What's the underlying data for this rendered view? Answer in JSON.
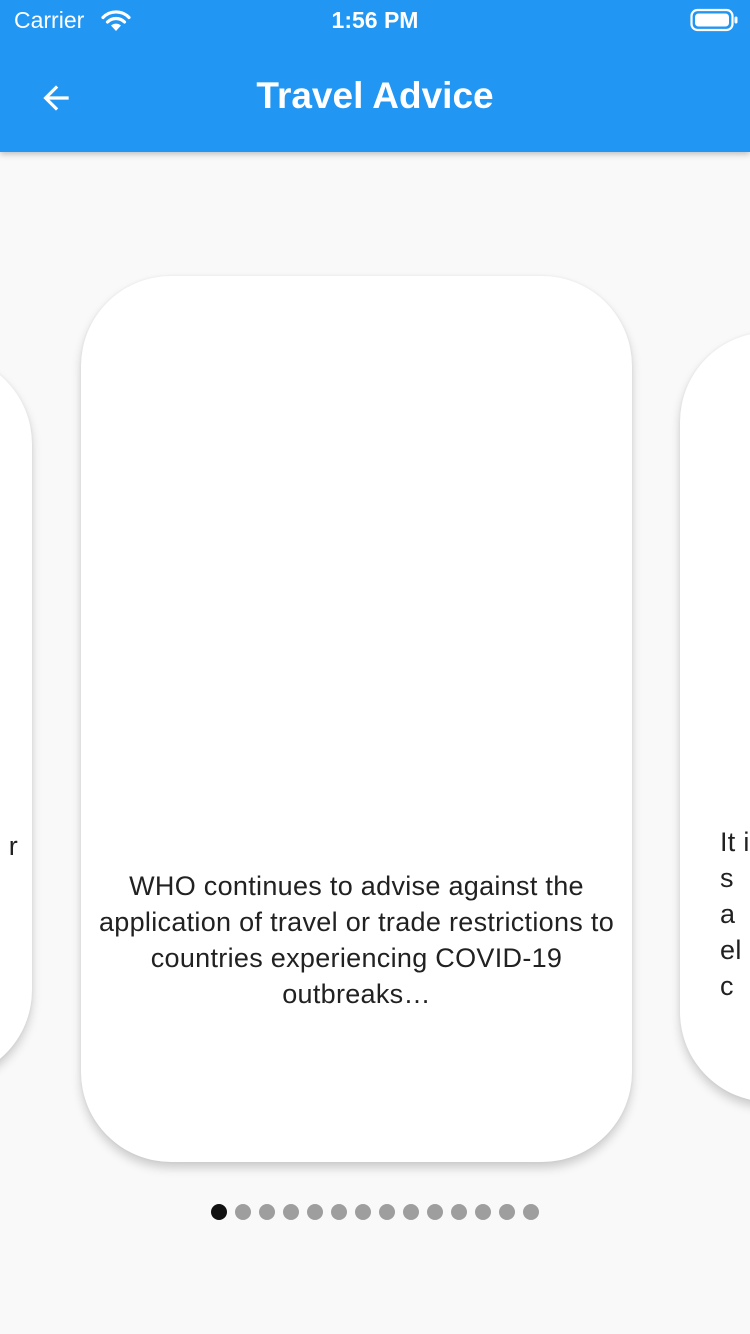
{
  "status_bar": {
    "carrier": "Carrier",
    "time": "1:56 PM",
    "wifi_icon": "wifi-icon",
    "battery_icon": "battery-icon"
  },
  "app_bar": {
    "title": "Travel Advice",
    "back_icon": "arrow-left-icon",
    "background_color": "#2196f3"
  },
  "carousel": {
    "current_index": 1,
    "total_pages": 14,
    "cards": [
      {
        "text": "r"
      },
      {
        "text": "WHO continues to advise against the application of travel or trade restrictions to countries experiencing COVID-19 outbreaks…"
      },
      {
        "text": "It i\ns\na\nel\nc"
      }
    ]
  },
  "page_indicator": {
    "active_color": "#111111",
    "inactive_color": "#9e9e9e"
  }
}
